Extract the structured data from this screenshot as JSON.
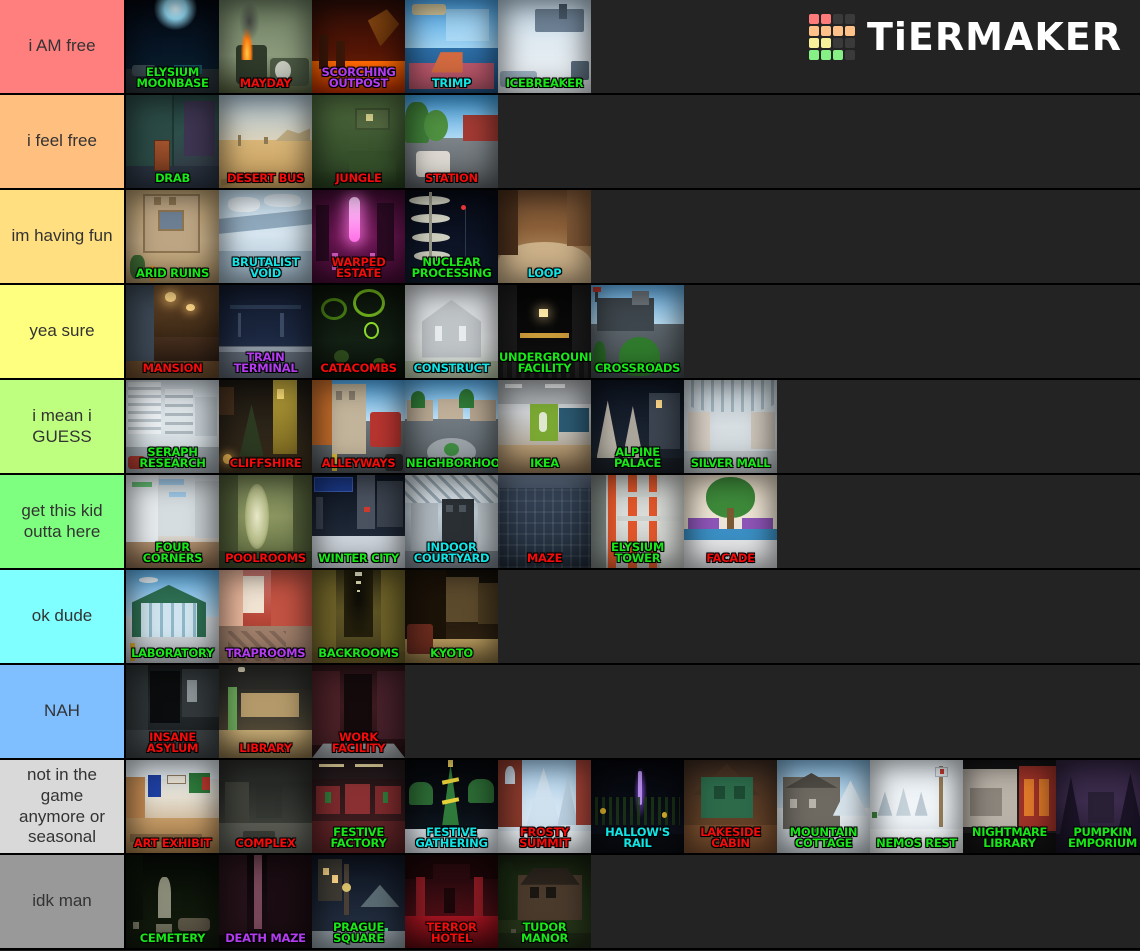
{
  "app": {
    "brand": "TiERMAKER",
    "logo_grid": [
      [
        "#ff7b7b",
        "#ff7b7b",
        "#3a3a3a",
        "#3a3a3a"
      ],
      [
        "#ffc18a",
        "#ffc18a",
        "#ffc18a",
        "#ffc18a"
      ],
      [
        "#f7f09a",
        "#f7f09a",
        "#3a3a3a",
        "#3a3a3a"
      ],
      [
        "#86ef86",
        "#86ef86",
        "#86ef86",
        "#3a3a3a"
      ]
    ]
  },
  "tiers": [
    {
      "label": "i AM free",
      "color": "#ff7f7f",
      "items": [
        {
          "name": "ELYSIUM MOONBASE",
          "label_color": "green",
          "art": "moonbase"
        },
        {
          "name": "MAYDAY",
          "label_color": "red",
          "art": "mayday"
        },
        {
          "name": "SCORCHING OUTPOST",
          "label_color": "purple",
          "art": "scorching"
        },
        {
          "name": "TRIMP",
          "label_color": "cyan",
          "art": "trimp"
        },
        {
          "name": "ICEBREAKER",
          "label_color": "green",
          "art": "icebreaker"
        }
      ]
    },
    {
      "label": "i feel free",
      "color": "#ffbf7f",
      "items": [
        {
          "name": "DRAB",
          "label_color": "green",
          "art": "drab"
        },
        {
          "name": "DESERT BUS",
          "label_color": "red",
          "art": "desertbus"
        },
        {
          "name": "JUNGLE",
          "label_color": "red",
          "art": "jungle"
        },
        {
          "name": "STATION",
          "label_color": "red",
          "art": "station"
        }
      ]
    },
    {
      "label": "im having fun",
      "color": "#ffdf7f",
      "items": [
        {
          "name": "ARID RUINS",
          "label_color": "green",
          "art": "arid"
        },
        {
          "name": "BRUTALIST VOID",
          "label_color": "cyan",
          "art": "brutalist"
        },
        {
          "name": "WARPED ESTATE",
          "label_color": "red",
          "art": "warped"
        },
        {
          "name": "NUCLEAR PROCESSING",
          "label_color": "green",
          "art": "nuclear"
        },
        {
          "name": "LOOP",
          "label_color": "cyan",
          "art": "loop"
        }
      ]
    },
    {
      "label": "yea sure",
      "color": "#ffff7f",
      "items": [
        {
          "name": "MANSION",
          "label_color": "red",
          "art": "mansion"
        },
        {
          "name": "TRAIN TERMINAL",
          "label_color": "purple",
          "art": "trainterminal"
        },
        {
          "name": "CATACOMBS",
          "label_color": "red",
          "art": "catacombs"
        },
        {
          "name": "CONSTRUCT",
          "label_color": "cyan",
          "art": "construct"
        },
        {
          "name": "UNDERGROUND FACILITY",
          "label_color": "green",
          "art": "underground"
        },
        {
          "name": "CROSSROADS",
          "label_color": "green",
          "art": "crossroads"
        }
      ]
    },
    {
      "label": "i mean i GUESS",
      "color": "#bfff7f",
      "items": [
        {
          "name": "SERAPH RESEARCH",
          "label_color": "green",
          "art": "seraph"
        },
        {
          "name": "CLIFFSHIRE",
          "label_color": "red",
          "art": "cliffshire"
        },
        {
          "name": "ALLEYWAYS",
          "label_color": "red",
          "art": "alleyways"
        },
        {
          "name": "NEIGHBORHOOD",
          "label_color": "green",
          "art": "neighborhood"
        },
        {
          "name": "IKEA",
          "label_color": "green",
          "art": "ikea"
        },
        {
          "name": "ALPINE PALACE",
          "label_color": "green",
          "art": "alpine"
        },
        {
          "name": "SILVER MALL",
          "label_color": "green",
          "art": "silvermall"
        }
      ]
    },
    {
      "label": "get this kid outta here",
      "color": "#7fff7f",
      "items": [
        {
          "name": "FOUR CORNERS",
          "label_color": "green",
          "art": "fourcorners"
        },
        {
          "name": "POOLROOMS",
          "label_color": "red",
          "art": "poolrooms"
        },
        {
          "name": "WINTER CITY",
          "label_color": "green",
          "art": "wintercity"
        },
        {
          "name": "INDOOR COURTYARD",
          "label_color": "cyan",
          "art": "indoorcourt"
        },
        {
          "name": "MAZE",
          "label_color": "red",
          "art": "maze"
        },
        {
          "name": "ELYSIUM TOWER",
          "label_color": "green",
          "art": "elysiumtower"
        },
        {
          "name": "FACADE",
          "label_color": "red",
          "art": "facade"
        }
      ]
    },
    {
      "label": "ok dude",
      "color": "#7fffff",
      "items": [
        {
          "name": "LABORATORY",
          "label_color": "green",
          "art": "laboratory"
        },
        {
          "name": "TRAPROOMS",
          "label_color": "purple",
          "art": "traprooms"
        },
        {
          "name": "BACKROOMS",
          "label_color": "green",
          "art": "backrooms"
        },
        {
          "name": "KYOTO",
          "label_color": "green",
          "art": "kyoto"
        }
      ]
    },
    {
      "label": "NAH",
      "color": "#7fbfff",
      "items": [
        {
          "name": "INSANE ASYLUM",
          "label_color": "red",
          "art": "asylum"
        },
        {
          "name": "LIBRARY",
          "label_color": "red",
          "art": "library"
        },
        {
          "name": "WORK FACILITY",
          "label_color": "red",
          "art": "workfacility"
        }
      ]
    },
    {
      "label": "not in the game anymore or seasonal",
      "color": "#d9d9d9",
      "items": [
        {
          "name": "ART EXHIBIT",
          "label_color": "red",
          "art": "artexhibit"
        },
        {
          "name": "COMPLEX",
          "label_color": "red",
          "art": "complex"
        },
        {
          "name": "FESTIVE FACTORY",
          "label_color": "green",
          "art": "festivefactory"
        },
        {
          "name": "FESTIVE GATHERING",
          "label_color": "cyan",
          "art": "festivegathering"
        },
        {
          "name": "FROSTY SUMMIT",
          "label_color": "red",
          "art": "frosty"
        },
        {
          "name": "HALLOW'S RAIL",
          "label_color": "cyan",
          "art": "hallows"
        },
        {
          "name": "LAKESIDE CABIN",
          "label_color": "red",
          "art": "lakeside"
        },
        {
          "name": "MOUNTAIN COTTAGE",
          "label_color": "green",
          "art": "mountain"
        },
        {
          "name": "NEMOS REST",
          "label_color": "green",
          "art": "nemos"
        },
        {
          "name": "NIGHTMARE LIBRARY",
          "label_color": "green",
          "art": "nightmare"
        },
        {
          "name": "PUMPKIN EMPORIUM",
          "label_color": "green",
          "art": "pumpkin"
        }
      ]
    },
    {
      "label": "idk man",
      "color": "#999999",
      "items": [
        {
          "name": "CEMETERY",
          "label_color": "green",
          "art": "cemetery"
        },
        {
          "name": "DEATH MAZE",
          "label_color": "purple",
          "art": "deathmaze"
        },
        {
          "name": "PRAGUE SQUARE",
          "label_color": "green",
          "art": "prague"
        },
        {
          "name": "TERROR HOTEL",
          "label_color": "red",
          "art": "terrorhotel"
        },
        {
          "name": "TUDOR MANOR",
          "label_color": "green",
          "art": "tudor"
        }
      ]
    }
  ]
}
